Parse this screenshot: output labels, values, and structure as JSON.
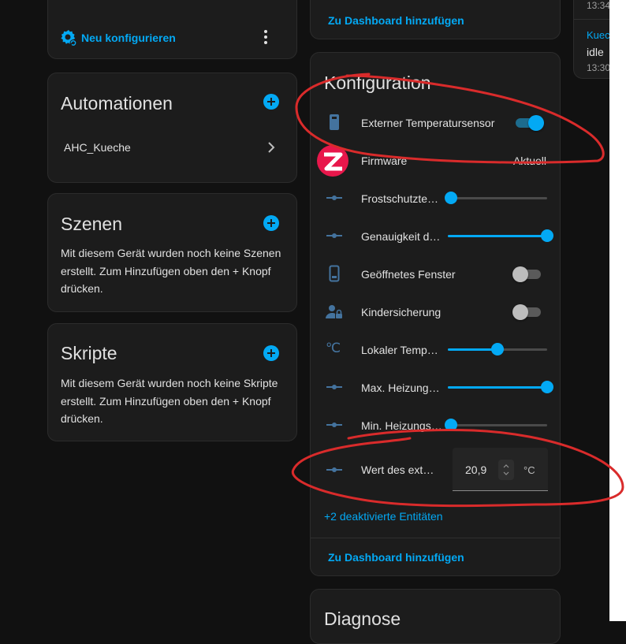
{
  "top_left_card": {
    "reconfigure_label": "Neu konfigurieren"
  },
  "automations": {
    "title": "Automationen",
    "items": [
      {
        "label": "AHC_Kueche"
      }
    ]
  },
  "scenes": {
    "title": "Szenen",
    "empty_text": "Mit diesem Gerät wurden noch keine Szenen erstellt. Zum Hinzufügen oben den + Knopf drücken."
  },
  "scripts": {
    "title": "Skripte",
    "empty_text": "Mit diesem Gerät wurden noch keine Skripte erstellt. Zum Hinzufügen oben den + Knopf drücken."
  },
  "top_middle_card": {
    "dashboard_link": "Zu Dashboard hinzufügen"
  },
  "configuration": {
    "title": "Konfiguration",
    "rows": [
      {
        "label": "Externer Temperatursensor",
        "type": "toggle",
        "on": true,
        "icon": "device-icon"
      },
      {
        "label": "Firmware",
        "type": "text",
        "value": "Aktuell",
        "icon": "zigbee-icon"
      },
      {
        "label": "Frostschutzte…",
        "type": "slider",
        "fraction": 0.03,
        "icon": "number-icon"
      },
      {
        "label": "Genauigkeit d…",
        "type": "slider",
        "fraction": 1.0,
        "icon": "number-icon"
      },
      {
        "label": "Geöffnetes Fenster",
        "type": "toggle",
        "on": false,
        "icon": "window-icon"
      },
      {
        "label": "Kindersicherung",
        "type": "toggle",
        "on": false,
        "icon": "child-lock-icon"
      },
      {
        "label": "Lokaler Temp…",
        "type": "slider",
        "fraction": 0.5,
        "icon": "celsius-icon"
      },
      {
        "label": "Max. Heizung…",
        "type": "slider",
        "fraction": 1.0,
        "icon": "number-icon"
      },
      {
        "label": "Min. Heizungs…",
        "type": "slider",
        "fraction": 0.03,
        "icon": "number-icon"
      }
    ],
    "external_value": {
      "label": "Wert des ext…",
      "value": "20,9",
      "unit": "°C"
    },
    "disabled_link": "+2 deaktivierte Entitäten",
    "dashboard_link": "Zu Dashboard hinzufügen"
  },
  "diagnostics": {
    "title": "Diagnose"
  },
  "logbook": {
    "entries": [
      {
        "time": "13:34"
      },
      {
        "name": "Kueche",
        "state": "idle",
        "time": "13:30"
      }
    ]
  },
  "colors": {
    "accent": "#03a9f4",
    "annotation": "#d92b2b",
    "zigbee": "#e8174b"
  }
}
